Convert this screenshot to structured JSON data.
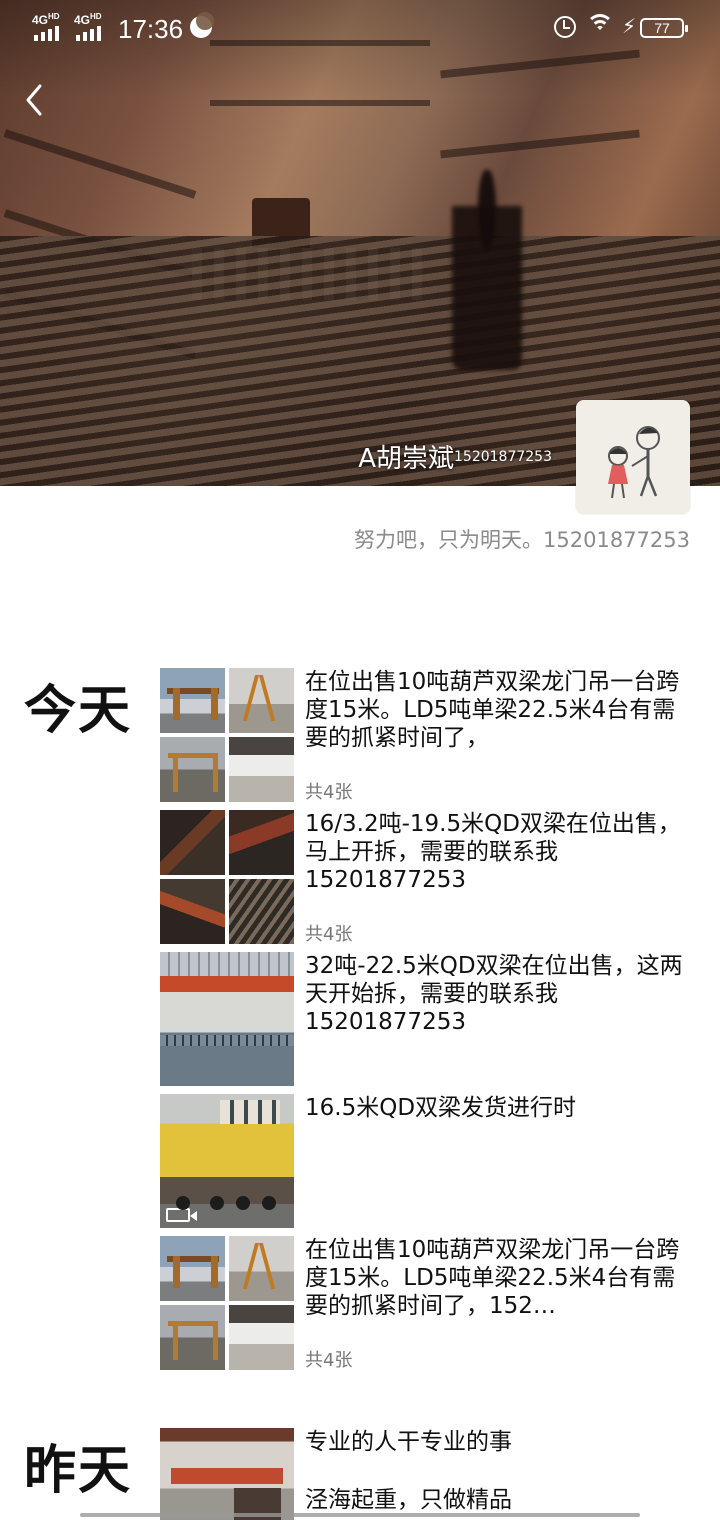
{
  "status_bar": {
    "network1": "4G",
    "network1_sup": "HD",
    "network2": "4G",
    "network2_sup": "HD",
    "time": "17:36",
    "battery": "77"
  },
  "profile": {
    "name": "A胡崇斌",
    "name_suffix": "15201877253",
    "signature": "努力吧，只为明天。15201877253"
  },
  "feed": {
    "days": [
      {
        "label": "今天",
        "posts": [
          {
            "text": "在位出售10吨葫芦双梁龙门吊一台跨度15米。LD5吨单梁22.5米4台有需要的抓紧时间了，",
            "count": "共4张"
          },
          {
            "text": "16/3.2吨-19.5米QD双梁在位出售，马上开拆，需要的联系我15201877253",
            "count": "共4张"
          },
          {
            "text": "32吨-22.5米QD双梁在位出售，这两天开始拆，需要的联系我15201877253",
            "count": ""
          },
          {
            "text": "16.5米QD双梁发货进行时",
            "count": ""
          },
          {
            "text": "在位出售10吨葫芦双梁龙门吊一台跨度15米。LD5吨单梁22.5米4台有需要的抓紧时间了，152…",
            "count": "共4张"
          }
        ]
      },
      {
        "label": "昨天",
        "posts": [
          {
            "line1": "专业的人干专业的事",
            "line2": "泾海起重，只做精品"
          }
        ]
      }
    ]
  }
}
